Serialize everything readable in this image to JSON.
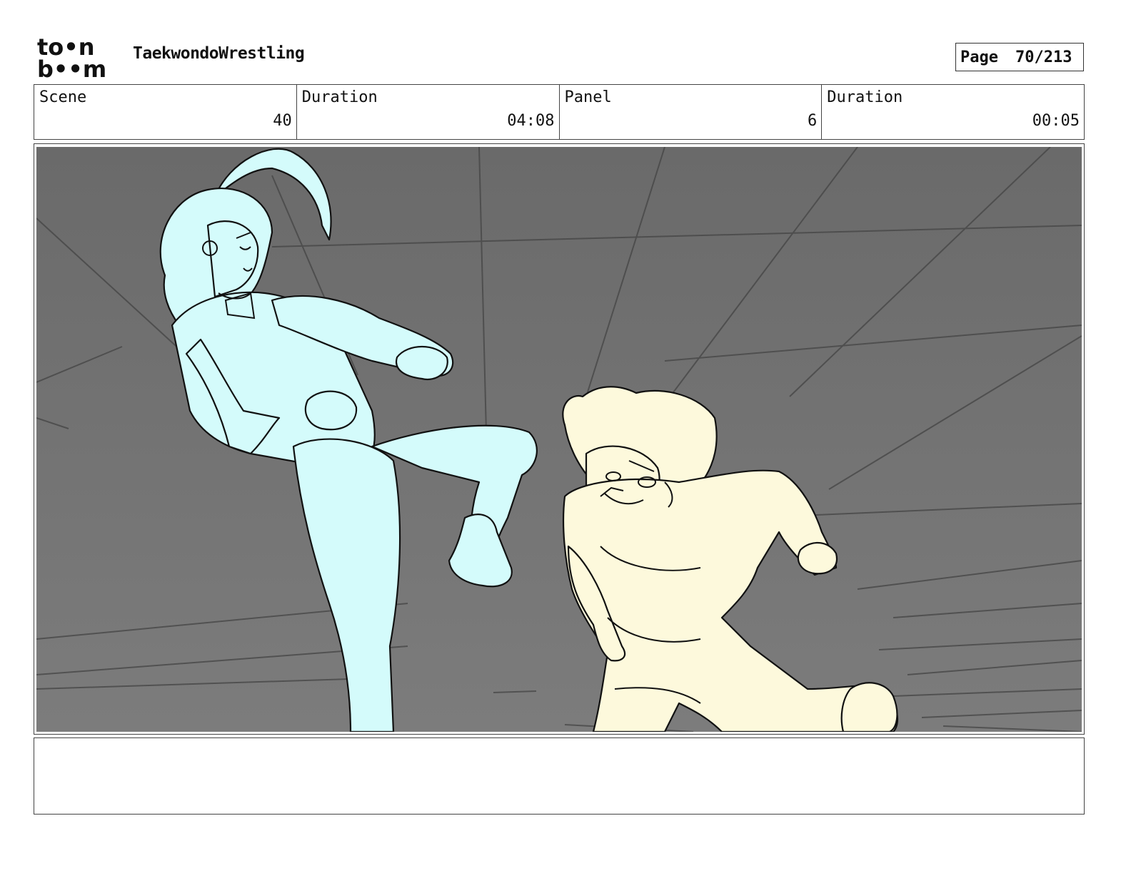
{
  "header": {
    "logo_top": "to•n",
    "logo_bottom": "b••m",
    "project_title": "TaekwondoWrestling",
    "page_label": "Page",
    "page_value": "70/213"
  },
  "info": {
    "scene_label": "Scene",
    "scene_value": "40",
    "scene_duration_label": "Duration",
    "scene_duration_value": "04:08",
    "panel_label": "Panel",
    "panel_value": "6",
    "panel_duration_label": "Duration",
    "panel_duration_value": "00:05"
  },
  "colors": {
    "background": "#6f6f6f",
    "left_fighter": "#d4fbfb",
    "right_fighter": "#fdf9dc",
    "line": "#111111"
  },
  "notes": {
    "text": ""
  }
}
